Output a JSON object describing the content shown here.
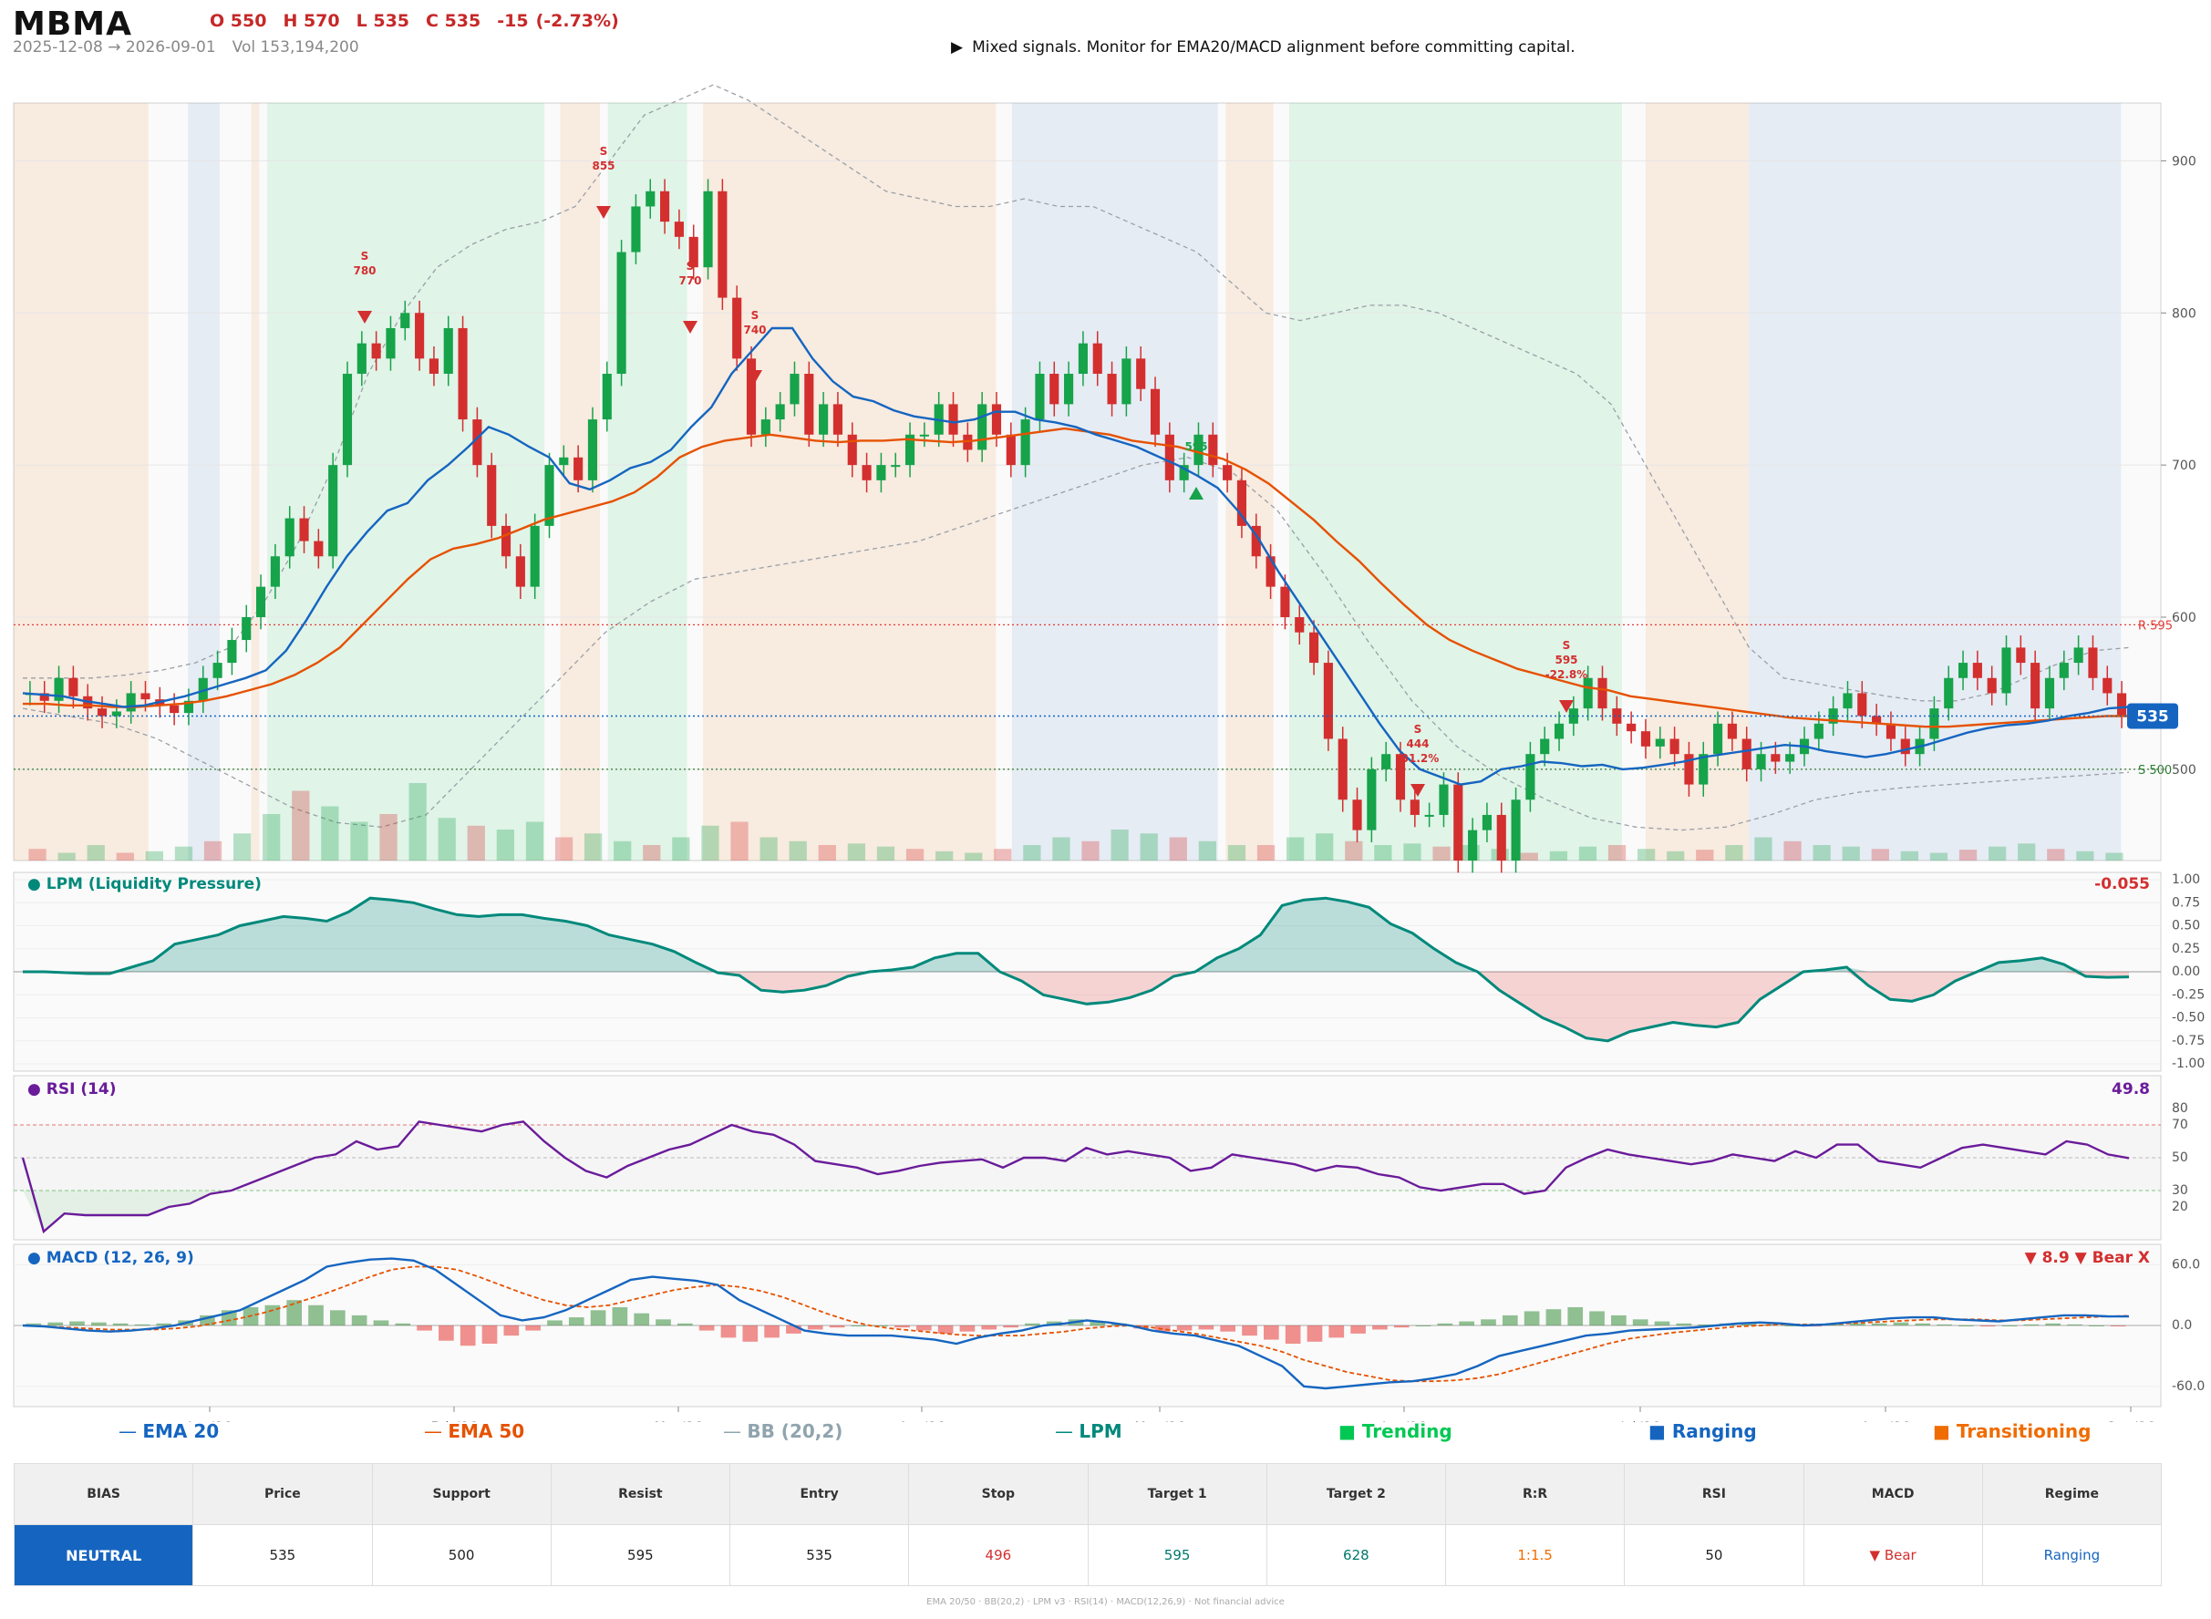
{
  "header": {
    "ticker": "MBMA",
    "open": "O 550",
    "high": "H 570",
    "low": "L 535",
    "close": "C 535",
    "change": "-15",
    "change_pct": "(-2.73%)",
    "date_range": "2025-12-08 → 2026-09-01",
    "volume": "Vol 153,194,200",
    "signal_icon": "▶",
    "signal_text": "Mixed signals. Monitor for EMA20/MACD alignment before committing capital."
  },
  "colors": {
    "up": "#16a34a",
    "down": "#d32f2f",
    "ema20": "#1565c0",
    "ema50": "#e65100",
    "bb": "#9aa0a6",
    "lpm": "#00897b",
    "rsi": "#6a1b9a",
    "macd": "#1565c0",
    "signal": "#e65100",
    "trending": "#00c853",
    "ranging": "#1565c0",
    "transitioning": "#ef6c00",
    "bias_neutral": "#1565c0"
  },
  "chart_data": [
    {
      "type": "candlestick",
      "panel": "price",
      "x_ticks": [
        "Jan '26",
        "Feb '26",
        "Mar '26",
        "Apr '26",
        "May '26",
        "Jun '26",
        "Jul '26",
        "Aug '26",
        "Sep '26"
      ],
      "y_ticks": [
        500,
        600,
        700,
        800,
        900
      ],
      "ylim": [
        440,
        938
      ],
      "last_price": 535,
      "resistance": {
        "label": "R 595",
        "value": 595
      },
      "support": {
        "label": "S 500",
        "value": 500
      },
      "closes": [
        550,
        545,
        560,
        548,
        540,
        535,
        538,
        550,
        546,
        542,
        537,
        545,
        560,
        570,
        585,
        600,
        620,
        640,
        665,
        650,
        640,
        700,
        760,
        780,
        770,
        790,
        800,
        770,
        760,
        790,
        730,
        700,
        660,
        640,
        620,
        660,
        700,
        705,
        690,
        730,
        760,
        840,
        870,
        880,
        860,
        850,
        830,
        880,
        810,
        770,
        720,
        730,
        740,
        760,
        720,
        740,
        720,
        700,
        690,
        700,
        700,
        720,
        720,
        740,
        720,
        710,
        740,
        720,
        700,
        730,
        760,
        740,
        760,
        780,
        760,
        740,
        770,
        750,
        720,
        690,
        700,
        720,
        700,
        690,
        660,
        640,
        620,
        600,
        590,
        570,
        520,
        480,
        460,
        500,
        510,
        480,
        470,
        470,
        490,
        440,
        460,
        470,
        440,
        480,
        510,
        520,
        530,
        540,
        560,
        540,
        530,
        525,
        515,
        520,
        510,
        490,
        510,
        530,
        520,
        500,
        510,
        505,
        510,
        520,
        530,
        540,
        550,
        535,
        530,
        520,
        510,
        520,
        540,
        560,
        570,
        560,
        550,
        580,
        570,
        540,
        560,
        570,
        580,
        560,
        550,
        535
      ],
      "ema20": [
        550,
        549,
        548,
        545,
        543,
        541,
        542,
        545,
        548,
        552,
        556,
        560,
        565,
        578,
        598,
        620,
        640,
        656,
        670,
        675,
        690,
        700,
        712,
        725,
        720,
        712,
        705,
        688,
        684,
        690,
        698,
        702,
        710,
        725,
        738,
        760,
        775,
        790,
        790,
        770,
        755,
        745,
        742,
        736,
        732,
        730,
        728,
        730,
        735,
        735,
        730,
        728,
        725,
        720,
        716,
        712,
        706,
        700,
        693,
        685,
        670,
        652,
        630,
        610,
        590,
        570,
        550,
        530,
        512,
        500,
        495,
        490,
        492,
        500,
        502,
        505,
        504,
        502,
        503,
        500,
        501,
        503,
        505,
        508,
        510,
        512,
        514,
        516,
        515,
        512,
        510,
        508,
        510,
        513,
        516,
        520,
        524,
        527,
        529,
        530,
        532,
        535,
        537,
        540,
        541
      ],
      "ema50": [
        543,
        543,
        542,
        542,
        541,
        541,
        542,
        543,
        545,
        548,
        552,
        556,
        562,
        570,
        580,
        595,
        610,
        625,
        638,
        645,
        648,
        652,
        658,
        664,
        668,
        672,
        676,
        682,
        692,
        705,
        712,
        716,
        718,
        720,
        718,
        716,
        715,
        716,
        716,
        717,
        716,
        715,
        716,
        718,
        720,
        722,
        724,
        722,
        720,
        716,
        714,
        712,
        708,
        704,
        697,
        688,
        676,
        664,
        650,
        637,
        622,
        608,
        595,
        585,
        578,
        572,
        566,
        562,
        558,
        554,
        552,
        548,
        546,
        544,
        542,
        540,
        538,
        536,
        534,
        533,
        532,
        531,
        530,
        529,
        528,
        528,
        529,
        530,
        531,
        532,
        533,
        534,
        535,
        535
      ],
      "bb_upper": [
        560,
        560,
        560,
        562,
        565,
        570,
        580,
        610,
        650,
        700,
        760,
        800,
        830,
        845,
        855,
        860,
        870,
        900,
        930,
        940,
        950,
        940,
        925,
        910,
        895,
        880,
        875,
        870,
        870,
        875,
        870,
        870,
        860,
        850,
        840,
        820,
        800,
        795,
        800,
        805,
        805,
        800,
        790,
        780,
        770,
        760,
        740,
        700,
        660,
        620,
        580,
        560,
        556,
        552,
        548,
        545,
        545,
        550,
        560,
        570,
        578,
        580
      ],
      "bb_lower": [
        540,
        535,
        530,
        520,
        505,
        490,
        475,
        465,
        462,
        470,
        500,
        530,
        560,
        590,
        610,
        625,
        630,
        635,
        640,
        645,
        650,
        660,
        670,
        680,
        690,
        700,
        705,
        695,
        670,
        630,
        585,
        545,
        515,
        495,
        480,
        468,
        462,
        460,
        462,
        470,
        480,
        485,
        488,
        490,
        492,
        494,
        496,
        498
      ],
      "volume_relative": [
        0.15,
        0.1,
        0.2,
        0.1,
        0.12,
        0.18,
        0.25,
        0.35,
        0.6,
        0.9,
        0.7,
        0.5,
        0.6,
        1.0,
        0.55,
        0.45,
        0.4,
        0.5,
        0.3,
        0.35,
        0.25,
        0.2,
        0.3,
        0.45,
        0.5,
        0.3,
        0.25,
        0.2,
        0.22,
        0.18,
        0.15,
        0.12,
        0.1,
        0.15,
        0.2,
        0.3,
        0.25,
        0.4,
        0.35,
        0.3,
        0.25,
        0.2,
        0.2,
        0.3,
        0.35,
        0.25,
        0.2,
        0.22,
        0.18,
        0.2,
        0.15,
        0.1,
        0.12,
        0.18,
        0.2,
        0.15,
        0.12,
        0.14,
        0.2,
        0.3,
        0.25,
        0.2,
        0.18,
        0.15,
        0.12,
        0.1,
        0.14,
        0.18,
        0.22,
        0.15,
        0.12,
        0.1
      ],
      "regimes": [
        {
          "regime": "transitioning",
          "from": "2025-12-08",
          "to": "2025-12-25"
        },
        {
          "regime": "ranging",
          "from": "2025-12-30",
          "to": "2026-01-03"
        },
        {
          "regime": "transitioning",
          "from": "2026-01-07",
          "to": "2026-01-08"
        },
        {
          "regime": "trending",
          "from": "2026-01-09",
          "to": "2026-02-13"
        },
        {
          "regime": "transitioning",
          "from": "2026-02-15",
          "to": "2026-02-20"
        },
        {
          "regime": "trending",
          "from": "2026-02-21",
          "to": "2026-03-03"
        },
        {
          "regime": "transitioning",
          "from": "2026-03-05",
          "to": "2026-04-11"
        },
        {
          "regime": "ranging",
          "from": "2026-04-13",
          "to": "2026-05-09"
        },
        {
          "regime": "transitioning",
          "from": "2026-05-10",
          "to": "2026-05-16"
        },
        {
          "regime": "trending",
          "from": "2026-05-18",
          "to": "2026-06-29"
        },
        {
          "regime": "transitioning",
          "from": "2026-07-02",
          "to": "2026-07-15"
        },
        {
          "regime": "ranging",
          "from": "2026-07-15",
          "to": "2026-08-31"
        }
      ],
      "annotations": [
        {
          "type": "sell",
          "label": "S",
          "value": "780"
        },
        {
          "type": "sell",
          "label": "S",
          "value": "855"
        },
        {
          "type": "sell",
          "label": "S",
          "value": "770"
        },
        {
          "type": "sell",
          "label": "S",
          "value": "740"
        },
        {
          "type": "buy",
          "label": "",
          "value": "595"
        },
        {
          "type": "sell",
          "label": "S",
          "value": "444",
          "pct": "-31.2%"
        },
        {
          "type": "sell",
          "label": "S",
          "value": "595",
          "pct": "-22.8%"
        }
      ]
    },
    {
      "type": "area",
      "panel": "lpm",
      "title": "LPM (Liquidity Pressure)",
      "last_value": "-0.055",
      "y_ticks": [
        "1.00",
        "0.75",
        "0.50",
        "0.25",
        "0.00",
        "-0.25",
        "-0.50",
        "-0.75",
        "-1.00"
      ],
      "ylim": [
        -1.0,
        1.0
      ],
      "values": [
        0.0,
        0.0,
        -0.01,
        -0.02,
        -0.02,
        0.05,
        0.12,
        0.3,
        0.35,
        0.4,
        0.5,
        0.55,
        0.6,
        0.58,
        0.55,
        0.65,
        0.8,
        0.78,
        0.75,
        0.68,
        0.62,
        0.6,
        0.62,
        0.62,
        0.58,
        0.55,
        0.5,
        0.4,
        0.35,
        0.3,
        0.22,
        0.1,
        -0.01,
        -0.04,
        -0.2,
        -0.22,
        -0.2,
        -0.15,
        -0.05,
        0.0,
        0.02,
        0.05,
        0.15,
        0.2,
        0.2,
        0.0,
        -0.1,
        -0.25,
        -0.3,
        -0.35,
        -0.33,
        -0.28,
        -0.2,
        -0.05,
        0.0,
        0.15,
        0.25,
        0.4,
        0.72,
        0.78,
        0.8,
        0.76,
        0.7,
        0.52,
        0.42,
        0.25,
        0.1,
        0.0,
        -0.2,
        -0.35,
        -0.5,
        -0.6,
        -0.72,
        -0.75,
        -0.65,
        -0.6,
        -0.55,
        -0.58,
        -0.6,
        -0.55,
        -0.3,
        -0.15,
        0.0,
        0.02,
        0.05,
        -0.15,
        -0.3,
        -0.32,
        -0.25,
        -0.1,
        0.0,
        0.1,
        0.12,
        0.15,
        0.08,
        -0.05,
        -0.06,
        -0.055
      ]
    },
    {
      "type": "line",
      "panel": "rsi",
      "title": "RSI (14)",
      "last_value": "49.8",
      "y_ticks": [
        80,
        70,
        50,
        30,
        20
      ],
      "ylim": [
        0,
        100
      ],
      "overbought": 70,
      "oversold": 30,
      "values": [
        50,
        5,
        16,
        15,
        15,
        15,
        15,
        20,
        22,
        28,
        30,
        35,
        40,
        45,
        50,
        52,
        60,
        55,
        57,
        72,
        70,
        68,
        66,
        70,
        72,
        60,
        50,
        42,
        38,
        45,
        50,
        55,
        58,
        64,
        70,
        66,
        64,
        58,
        48,
        46,
        44,
        40,
        42,
        45,
        47,
        48,
        49,
        44,
        50,
        50,
        48,
        56,
        52,
        54,
        52,
        50,
        42,
        44,
        52,
        50,
        48,
        46,
        42,
        45,
        44,
        40,
        38,
        32,
        30,
        32,
        34,
        34,
        28,
        30,
        44,
        50,
        55,
        52,
        50,
        48,
        46,
        48,
        52,
        50,
        48,
        54,
        50,
        58,
        58,
        48,
        46,
        44,
        50,
        56,
        58,
        56,
        54,
        52,
        60,
        58,
        52,
        49.8
      ]
    },
    {
      "type": "line",
      "panel": "macd",
      "title": "MACD (12, 26, 9)",
      "last_value": "▼ 8.9 ▼ Bear X",
      "y_ticks": [
        "60.0",
        "0.0",
        "-60.0"
      ],
      "ylim": [
        -80,
        80
      ],
      "macd": [
        0,
        -1,
        -3,
        -5,
        -6,
        -5,
        -3,
        0,
        5,
        10,
        15,
        25,
        35,
        45,
        58,
        62,
        65,
        66,
        64,
        55,
        40,
        25,
        10,
        5,
        8,
        15,
        25,
        35,
        45,
        48,
        46,
        44,
        40,
        25,
        15,
        5,
        -5,
        -8,
        -10,
        -10,
        -10,
        -12,
        -14,
        -18,
        -12,
        -8,
        -5,
        0,
        2,
        5,
        3,
        0,
        -5,
        -8,
        -10,
        -15,
        -20,
        -30,
        -40,
        -60,
        -62,
        -60,
        -58,
        -56,
        -55,
        -52,
        -48,
        -40,
        -30,
        -25,
        -20,
        -15,
        -10,
        -8,
        -5,
        -4,
        -3,
        -2,
        0,
        2,
        3,
        2,
        0,
        1,
        3,
        5,
        7,
        8,
        8,
        6,
        5,
        4,
        6,
        8,
        10,
        10,
        9,
        8.9
      ],
      "signal": [
        0,
        -1,
        -2,
        -3,
        -4,
        -4,
        -4,
        -3,
        -1,
        3,
        7,
        12,
        18,
        25,
        32,
        40,
        48,
        55,
        58,
        58,
        55,
        48,
        40,
        32,
        25,
        20,
        18,
        20,
        25,
        30,
        35,
        38,
        40,
        38,
        34,
        28,
        20,
        12,
        5,
        0,
        -3,
        -5,
        -7,
        -9,
        -10,
        -10,
        -10,
        -8,
        -6,
        -3,
        -1,
        0,
        -2,
        -5,
        -8,
        -12,
        -16,
        -20,
        -26,
        -34,
        -40,
        -46,
        -50,
        -54,
        -55,
        -55,
        -54,
        -52,
        -48,
        -42,
        -36,
        -30,
        -24,
        -18,
        -13,
        -10,
        -7,
        -5,
        -3,
        -1,
        0,
        1,
        1,
        1,
        2,
        3,
        4,
        5,
        6,
        6,
        6,
        5,
        5,
        6,
        7,
        8,
        9,
        9.5
      ],
      "histogram": [
        2,
        3,
        4,
        3,
        2,
        1,
        2,
        5,
        10,
        15,
        18,
        20,
        25,
        20,
        15,
        10,
        5,
        2,
        -5,
        -15,
        -20,
        -18,
        -10,
        -5,
        5,
        8,
        15,
        18,
        12,
        6,
        2,
        -5,
        -12,
        -16,
        -12,
        -8,
        -4,
        -2,
        0,
        0,
        -2,
        -5,
        -8,
        -6,
        -4,
        -2,
        2,
        4,
        6,
        4,
        2,
        -3,
        -6,
        -5,
        -4,
        -6,
        -10,
        -14,
        -18,
        -16,
        -12,
        -8,
        -4,
        -2,
        0,
        2,
        4,
        6,
        10,
        14,
        16,
        18,
        14,
        10,
        6,
        4,
        2,
        1,
        2,
        2,
        1,
        0,
        -1,
        1,
        2,
        2,
        3,
        2,
        1,
        0,
        -1,
        0,
        1,
        2,
        1,
        0,
        -0.5
      ]
    }
  ],
  "legend": {
    "ema20": "EMA 20",
    "ema50": "EMA 50",
    "bb": "BB (20,2)",
    "lpm": "LPM",
    "trending": "Trending",
    "ranging": "Ranging",
    "transitioning": "Transitioning"
  },
  "levels_table": {
    "headers": [
      "BIAS",
      "Price",
      "Support",
      "Resist",
      "Entry",
      "Stop",
      "Target 1",
      "Target 2",
      "R:R",
      "RSI",
      "MACD",
      "Regime"
    ],
    "values": [
      "NEUTRAL",
      "535",
      "500",
      "595",
      "535",
      "496",
      "595",
      "628",
      "1:1.5",
      "50",
      "▼ Bear",
      "Ranging"
    ],
    "value_colors": [
      "#ffffff",
      "#222222",
      "#222222",
      "#222222",
      "#222222",
      "#d32f2f",
      "#00796b",
      "#00796b",
      "#ef6c00",
      "#222222",
      "#d32f2f",
      "#1565c0"
    ]
  },
  "footer": "EMA 20/50 · BB(20,2) · LPM v3 · RSI(14) · MACD(12,26,9) · Not financial advice"
}
